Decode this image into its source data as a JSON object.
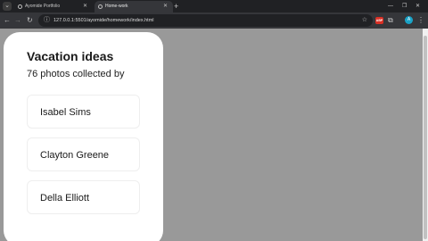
{
  "browser": {
    "tabs": [
      {
        "label": "Ayomide Portfolio",
        "active": false
      },
      {
        "label": "Home-work",
        "active": true
      }
    ],
    "url": "127.0.0.1:5501/ayomide/homework/index.html",
    "extension_badge": "ABP",
    "profile_initial": "A"
  },
  "card": {
    "title": "Vacation ideas",
    "subtitle": "76 photos collected by",
    "people": [
      {
        "name": "Isabel Sims"
      },
      {
        "name": "Clayton Greene"
      },
      {
        "name": "Della Elliott"
      }
    ]
  },
  "colors": {
    "page_background": "#999999",
    "card_background": "#ffffff",
    "chrome_dark": "#202124",
    "chrome_toolbar": "#35363a"
  }
}
